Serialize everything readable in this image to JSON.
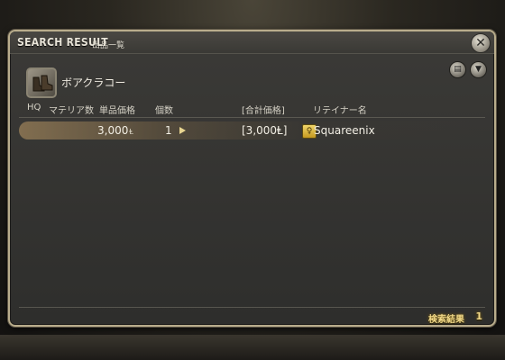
{
  "window": {
    "title": "SEARCH RESULT",
    "subtitle": "出品一覧",
    "close_icon": "close-icon"
  },
  "item": {
    "name": "ボアクラコー",
    "icon": "boots-icon"
  },
  "toolbar": {
    "history_icon": "history-icon",
    "filter_icon": "filter-icon"
  },
  "columns": {
    "hq": "HQ",
    "materia": "マテリア数",
    "unit_price": "単品価格",
    "quantity": "個数",
    "total": "[合計価格]",
    "retainer": "リテイナー名"
  },
  "listings": [
    {
      "unit_price": "3,000",
      "currency": "Ⱡ",
      "quantity": "1",
      "total": "[3,000Ⱡ]",
      "retainer_icon": "retainer-icon",
      "retainer": "Squareenix"
    }
  ],
  "footer": {
    "label": "検索結果",
    "count": "1"
  },
  "colors": {
    "frame": "#b9ad8c",
    "accent_gold": "#f1d98a",
    "panel": "#333230"
  }
}
